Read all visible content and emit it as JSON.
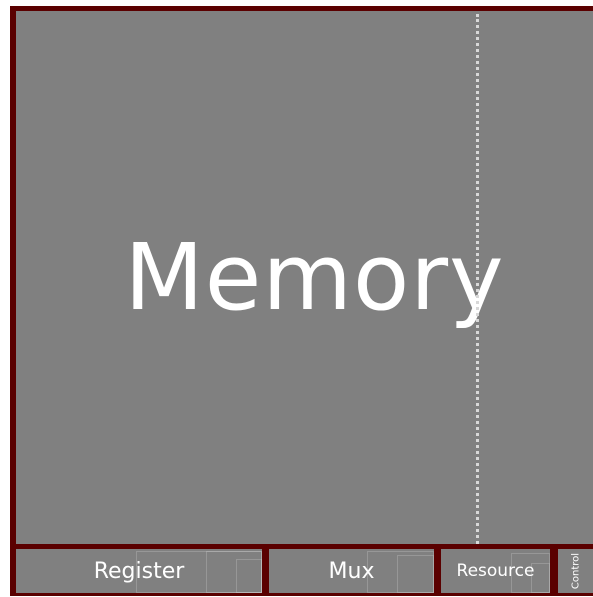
{
  "treemap": {
    "cells": [
      {
        "label": "Memory"
      },
      {
        "label": "Register"
      },
      {
        "label": "Mux"
      },
      {
        "label": "Resource"
      },
      {
        "label": "Control"
      }
    ],
    "colors": {
      "border": "#5a0000",
      "cell": "#808080",
      "text": "#ffffff",
      "marker": "#d8d8d8"
    }
  }
}
